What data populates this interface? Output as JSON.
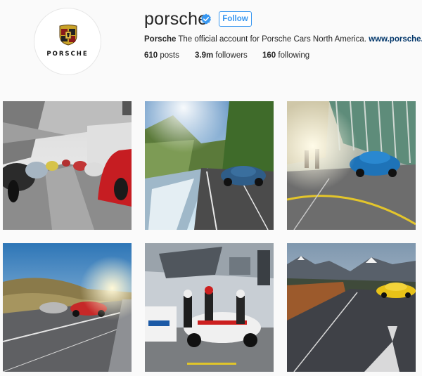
{
  "profile": {
    "username": "porsche",
    "follow_label": "Follow",
    "logo_text": "PORSCHE",
    "bio": {
      "name": "Porsche",
      "text": "The official account for Porsche Cars North America.",
      "link": "www.porsche.com"
    },
    "stats": {
      "posts": {
        "value": "610",
        "label": "posts"
      },
      "followers": {
        "value": "3.9m",
        "label": "followers"
      },
      "following": {
        "value": "160",
        "label": "following"
      }
    }
  },
  "icons": {
    "verified": "verified-badge-icon",
    "crest": "porsche-crest-icon"
  },
  "colors": {
    "accent": "#3897f0",
    "verified": "#3897f0",
    "link": "#003569"
  },
  "posts": [
    {
      "subject": "red and silver sports cars lined up in showroom"
    },
    {
      "subject": "blue coupe on mountain road beside river"
    },
    {
      "subject": "blue SUV near glass building at sunset"
    },
    {
      "subject": "silver and red convertibles on coastal road"
    },
    {
      "subject": "race cars in pit lane"
    },
    {
      "subject": "yellow coupe on mountain road"
    }
  ]
}
